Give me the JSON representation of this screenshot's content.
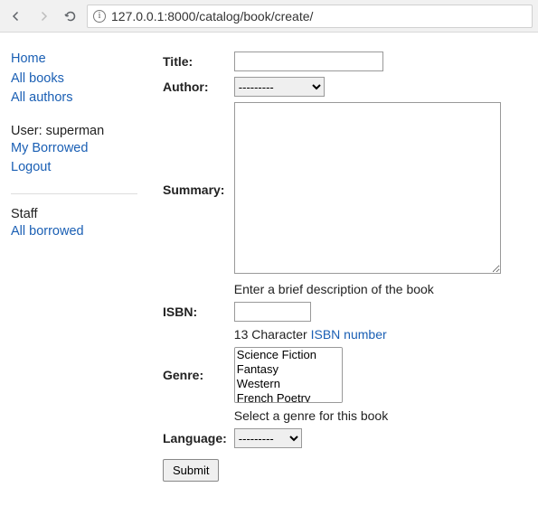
{
  "browser": {
    "url": "127.0.0.1:8000/catalog/book/create/"
  },
  "sidebar": {
    "nav": [
      {
        "label": "Home"
      },
      {
        "label": "All books"
      },
      {
        "label": "All authors"
      }
    ],
    "user_label": "User: superman",
    "user_links": [
      {
        "label": "My Borrowed"
      },
      {
        "label": "Logout"
      }
    ],
    "staff_label": "Staff",
    "staff_links": [
      {
        "label": "All borrowed"
      }
    ]
  },
  "form": {
    "title_label": "Title:",
    "title_value": "",
    "author_label": "Author:",
    "author_selected": "---------",
    "summary_label": "Summary:",
    "summary_value": "",
    "summary_help": "Enter a brief description of the book",
    "isbn_label": "ISBN:",
    "isbn_value": "",
    "isbn_help_prefix": "13 Character ",
    "isbn_help_link": "ISBN number",
    "genre_label": "Genre:",
    "genre_options": [
      "Science Fiction",
      "Fantasy",
      "Western",
      "French Poetry"
    ],
    "genre_help": "Select a genre for this book",
    "language_label": "Language:",
    "language_selected": "---------",
    "submit_label": "Submit"
  }
}
